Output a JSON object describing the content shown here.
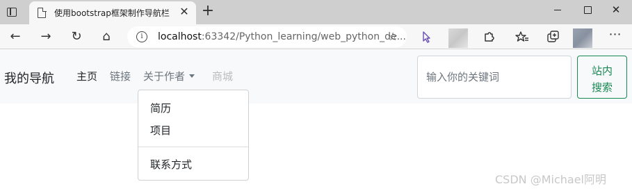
{
  "browser": {
    "tab_title": "使用bootstrap框架制作导航栏",
    "tab_close": "✕",
    "new_tab": "+",
    "window_min": "",
    "window_max": "",
    "window_close": "✕",
    "nav_back": "←",
    "nav_forward": "→",
    "nav_reload": "↻",
    "nav_home": "⌂",
    "info": "i",
    "url_host": "localhost",
    "url_path": ":63342/Python_learning/web_python_de...",
    "favorite_add": "☆",
    "more": "⋯",
    "icons": [
      "window-icon",
      "page-icon",
      "back-icon",
      "forward-icon",
      "reload-icon",
      "home-icon",
      "info-icon",
      "favorite-add-icon",
      "cursor-icon",
      "extensions-icon",
      "favorites-icon",
      "collections-icon",
      "more-icon"
    ]
  },
  "navbar": {
    "brand": "我的导航",
    "items": [
      {
        "label": "主页"
      },
      {
        "label": "链接"
      },
      {
        "label": "关于作者"
      },
      {
        "label": "商城"
      }
    ],
    "search": {
      "placeholder": "输入你的关键词",
      "button_line1": "站内",
      "button_line2": "搜索",
      "button_color": "#198754"
    }
  },
  "dropdown": {
    "items": [
      {
        "label": "简历"
      },
      {
        "label": "项目"
      },
      {
        "label": "联系方式"
      }
    ]
  },
  "watermark": "CSDN @Michael阿明"
}
